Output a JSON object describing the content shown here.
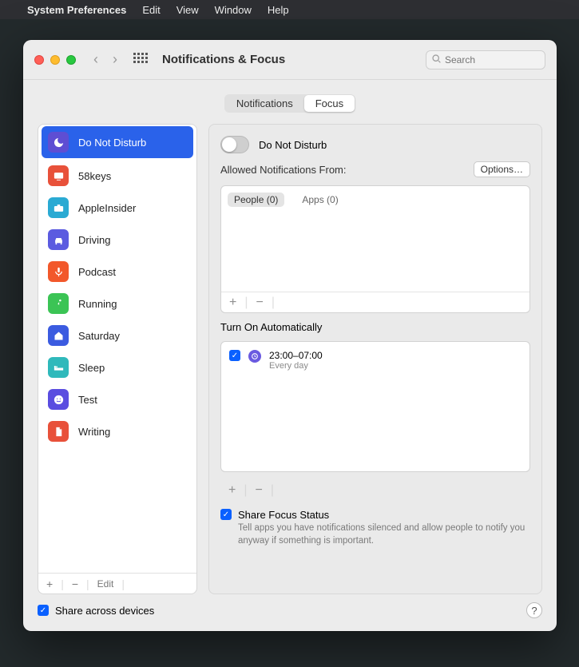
{
  "menubar": {
    "app_name": "System Preferences",
    "items": [
      "Edit",
      "View",
      "Window",
      "Help"
    ]
  },
  "window": {
    "title": "Notifications & Focus",
    "search_placeholder": "Search"
  },
  "tabs": {
    "left": "Notifications",
    "right": "Focus"
  },
  "sidebar": {
    "items": [
      {
        "label": "Do Not Disturb",
        "color": "#5e4ed3",
        "icon": "moon"
      },
      {
        "label": "58keys",
        "color": "#e8513a",
        "icon": "tv"
      },
      {
        "label": "AppleInsider",
        "color": "#2aaad3",
        "icon": "briefcase"
      },
      {
        "label": "Driving",
        "color": "#5b5be0",
        "icon": "car"
      },
      {
        "label": "Podcast",
        "color": "#f2582b",
        "icon": "mic"
      },
      {
        "label": "Running",
        "color": "#3bc455",
        "icon": "runner"
      },
      {
        "label": "Saturday",
        "color": "#3b5be0",
        "icon": "home"
      },
      {
        "label": "Sleep",
        "color": "#2fb9bb",
        "icon": "bed"
      },
      {
        "label": "Test",
        "color": "#5a4de0",
        "icon": "smile"
      },
      {
        "label": "Writing",
        "color": "#e8513a",
        "icon": "doc"
      }
    ],
    "footer_edit": "Edit"
  },
  "detail": {
    "dnd_label": "Do Not Disturb",
    "allowed_label": "Allowed Notifications From:",
    "options_label": "Options…",
    "allowed_tabs": {
      "people": "People (0)",
      "apps": "Apps (0)"
    },
    "turn_on_label": "Turn On Automatically",
    "schedule": {
      "time": "23:00–07:00",
      "recurrence": "Every day"
    },
    "share_status": {
      "title": "Share Focus Status",
      "desc": "Tell apps you have notifications silenced and allow people to notify you anyway if something is important."
    }
  },
  "bottom": {
    "share_devices": "Share across devices",
    "help": "?"
  }
}
